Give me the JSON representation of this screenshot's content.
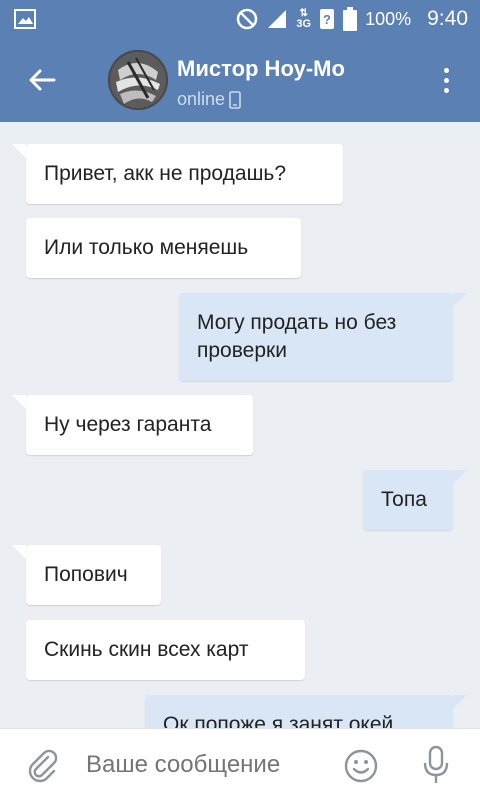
{
  "statusbar": {
    "battery": "100%",
    "time": "9:40",
    "network": "3G"
  },
  "header": {
    "title": "Мистор Ноу-Мо",
    "status": "online"
  },
  "messages": [
    {
      "direction": "in",
      "text": "Привет, акк не продашь?"
    },
    {
      "direction": "in",
      "text": "Или только меняешь"
    },
    {
      "direction": "out",
      "text": "Могу продать но без проверки"
    },
    {
      "direction": "in",
      "text": "Ну через гаранта"
    },
    {
      "direction": "out",
      "text": "Топа"
    },
    {
      "direction": "in",
      "text": "Попович"
    },
    {
      "direction": "in",
      "text": "Скинь скин всех карт"
    },
    {
      "direction": "out",
      "text": "Ок попоже я занят окей"
    }
  ],
  "composer": {
    "placeholder": "Ваше сообщение"
  },
  "colors": {
    "header": "#5b80b4",
    "background": "#ebeef2",
    "incoming": "#ffffff",
    "outgoing": "#d9e6f6"
  }
}
